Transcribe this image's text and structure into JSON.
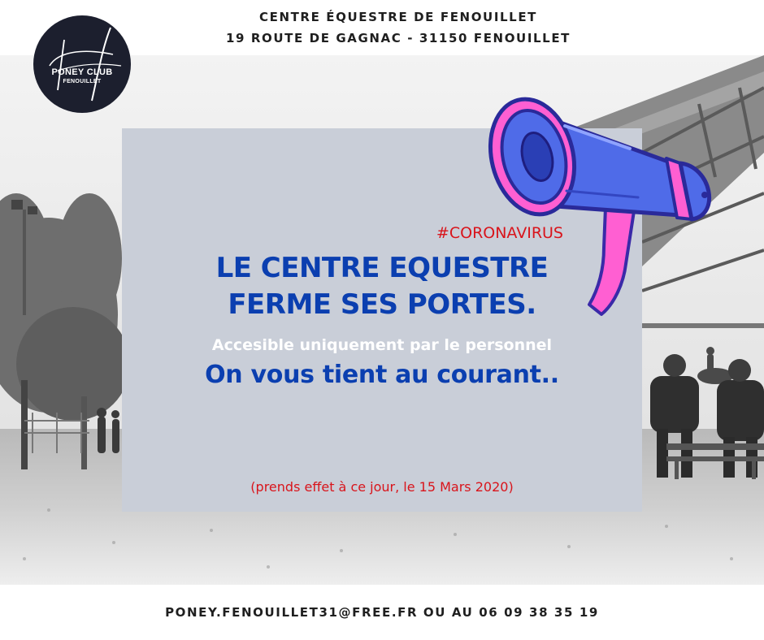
{
  "header": {
    "line1": "CENTRE ÉQUESTRE DE FENOUILLET",
    "line2": "19 ROUTE DE GAGNAC - 31150 FENOUILLET"
  },
  "logo": {
    "name_line1": "PONEY CLUB",
    "name_line2": "FENOUILLET",
    "background_color": "#1c1f2e"
  },
  "announcement": {
    "hashtag": "#CORONAVIRUS",
    "headline_line1": "LE CENTRE EQUESTRE",
    "headline_line2": "FERME SES PORTES.",
    "subline": "Accesible uniquement par le personnel",
    "info": "On vous tient au courant..",
    "note": "(prends effet à ce jour, le 15 Mars 2020)"
  },
  "footer": {
    "contact": "PONEY.FENOUILLET31@FREE.FR OU AU 06 09 38 35 19"
  },
  "icons": {
    "megaphone": "megaphone-icon"
  },
  "colors": {
    "headline_blue": "#0b3fb0",
    "alert_red": "#d9141b",
    "panel_gray": "#c9ced8",
    "megaphone_blue": "#4f6be8",
    "megaphone_pink": "#ff5fd2"
  }
}
